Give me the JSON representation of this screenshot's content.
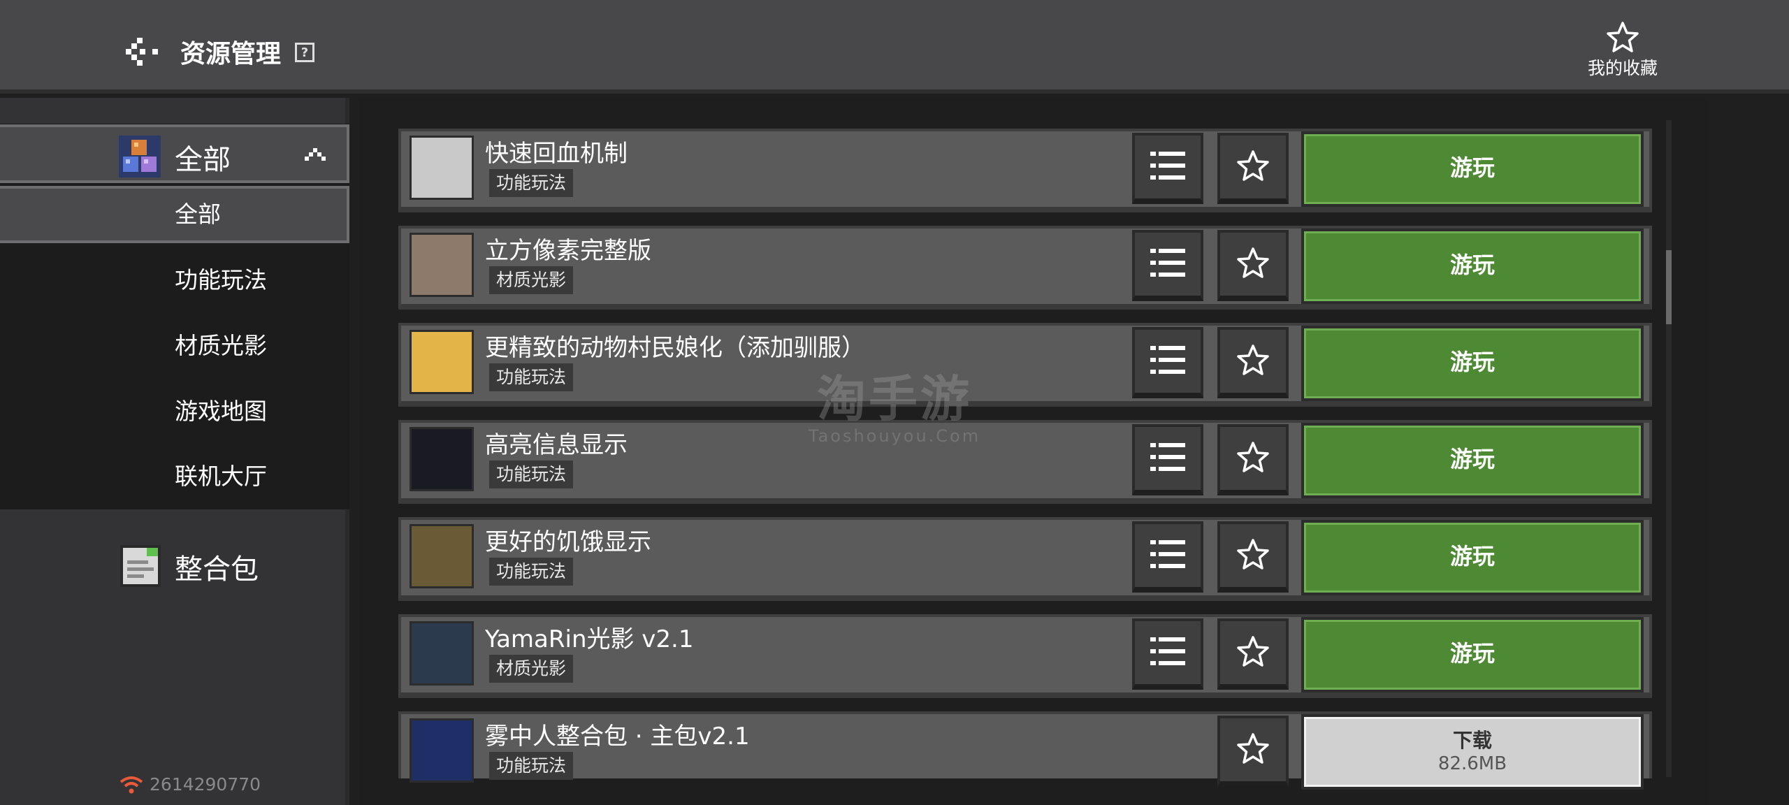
{
  "header": {
    "title": "资源管理",
    "help_label": "?",
    "favorites_label": "我的收藏"
  },
  "sidebar": {
    "category_header": "全部",
    "sub_items": [
      {
        "label": "全部",
        "active": true
      },
      {
        "label": "功能玩法",
        "active": false
      },
      {
        "label": "材质光影",
        "active": false
      },
      {
        "label": "游戏地图",
        "active": false
      },
      {
        "label": "联机大厅",
        "active": false
      }
    ],
    "pack_label": "整合包",
    "user_id": "2614290770"
  },
  "items": [
    {
      "name": "快速回血机制",
      "tag": "功能玩法",
      "action": "游玩",
      "thumb_color": "#c9c9c9"
    },
    {
      "name": "立方像素完整版",
      "tag": "材质光影",
      "action": "游玩",
      "thumb_color": "#8d7a6a"
    },
    {
      "name": "更精致的动物村民娘化（添加驯服）",
      "tag": "功能玩法",
      "action": "游玩",
      "thumb_color": "#e3b548"
    },
    {
      "name": "高亮信息显示",
      "tag": "功能玩法",
      "action": "游玩",
      "thumb_color": "#1a1a22"
    },
    {
      "name": "更好的饥饿显示",
      "tag": "功能玩法",
      "action": "游玩",
      "thumb_color": "#6b5a36"
    },
    {
      "name": "YamaRin光影 v2.1",
      "tag": "材质光影",
      "action": "游玩",
      "thumb_color": "#2c3a4e"
    },
    {
      "name": "雾中人整合包 · 主包v2.1",
      "tag": "功能玩法",
      "action": "下载",
      "size": "82.6MB",
      "thumb_color": "#1f2e66"
    }
  ],
  "watermark": {
    "line1": "淘手游",
    "line2": "Taoshouyou.Com"
  },
  "colors": {
    "play_green": "#4e8a34",
    "header_bg": "#48484a"
  }
}
